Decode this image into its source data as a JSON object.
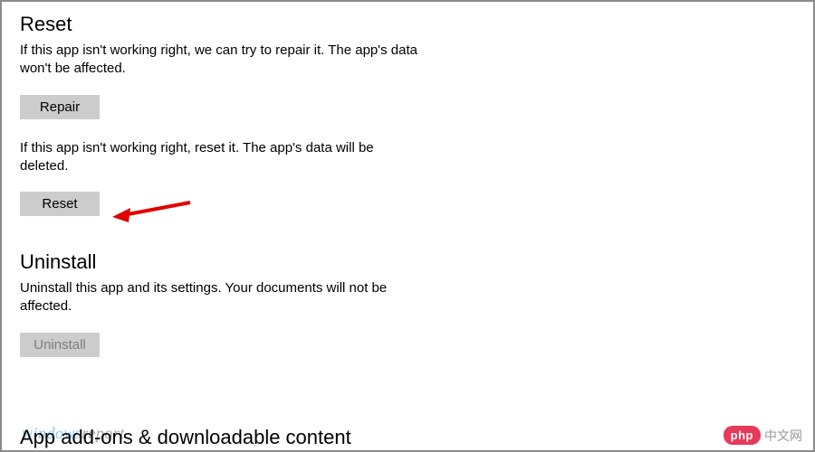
{
  "reset": {
    "heading": "Reset",
    "repair_desc": "If this app isn't working right, we can try to repair it. The app's data won't be affected.",
    "repair_label": "Repair",
    "reset_desc": "If this app isn't working right, reset it. The app's data will be deleted.",
    "reset_label": "Reset"
  },
  "uninstall": {
    "heading": "Uninstall",
    "desc": "Uninstall this app and its settings. Your documents will not be affected.",
    "button_label": "Uninstall"
  },
  "addons": {
    "heading": "App add-ons & downloadable content"
  },
  "watermarks": {
    "wr_blue": "windows",
    "wr_gray": "report",
    "php_pill": "php",
    "php_text": "中文网"
  },
  "annotation": {
    "arrow_color": "#e00000"
  }
}
